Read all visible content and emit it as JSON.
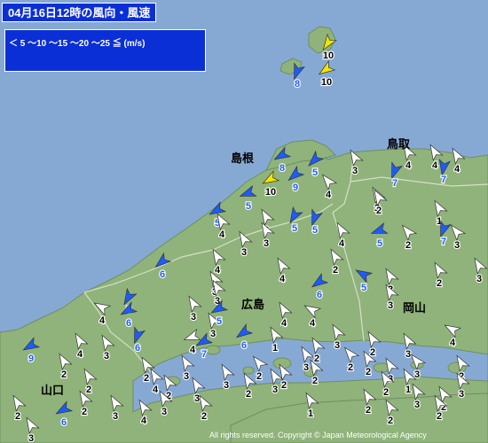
{
  "title": "04月16日12時の風向・風速",
  "legend": {
    "text": "＜ 5  ～10 ～15 ～20 ～25 ≦  (m/s)",
    "classes": [
      {
        "range": "< 5",
        "color": "#ffffff"
      },
      {
        "range": "5–10",
        "color": "#1e5bff"
      },
      {
        "range": "10–15",
        "color": "#f2e600"
      },
      {
        "range": "15–20",
        "color": "#ff8c00"
      },
      {
        "range": "20–25",
        "color": "#ff2800"
      },
      {
        "range": "≧ 25",
        "color": "#b4005a"
      }
    ]
  },
  "prefectures": {
    "shimane": "島根",
    "tottori": "鳥取",
    "hiroshima": "広島",
    "okayama": "岡山",
    "yamaguchi": "山口"
  },
  "credit": "All rights reserved. Copyright © Japan Meteorological Agency",
  "colors": {
    "sea": "#86a9d4",
    "land": "#8fb37a",
    "border": "#d6dfc6"
  },
  "stations": [
    {
      "speed": 10,
      "dir": 215,
      "label_color": "#000000"
    },
    {
      "speed": 10,
      "dir": 235,
      "label_color": "#000000"
    },
    {
      "speed": 8,
      "dir": 200,
      "label_color": "#1e5bff"
    },
    {
      "speed": 8,
      "dir": 240,
      "label_color": "#1e5bff"
    },
    {
      "speed": 5,
      "dir": 225,
      "label_color": "#1e5bff"
    },
    {
      "speed": 9,
      "dir": 230,
      "label_color": "#1e5bff"
    },
    {
      "speed": 10,
      "dir": 240,
      "label_color": "#000000"
    },
    {
      "speed": 3,
      "dir": 330,
      "label_color": "#000000"
    },
    {
      "speed": 4,
      "dir": 330,
      "label_color": "#000000"
    },
    {
      "speed": 7,
      "dir": 200,
      "label_color": "#1e5bff"
    },
    {
      "speed": 4,
      "dir": 330,
      "label_color": "#000000"
    },
    {
      "speed": 4,
      "dir": 330,
      "label_color": "#000000"
    },
    {
      "speed": 2,
      "dir": 330,
      "label_color": "#000000"
    },
    {
      "speed": 7,
      "dir": 190,
      "label_color": "#1e5bff"
    },
    {
      "speed": 4,
      "dir": 320,
      "label_color": "#000000"
    },
    {
      "speed": 5,
      "dir": 240,
      "label_color": "#1e5bff"
    },
    {
      "speed": 5,
      "dir": 250,
      "label_color": "#1e5bff"
    },
    {
      "speed": 5,
      "dir": 210,
      "label_color": "#1e5bff"
    },
    {
      "speed": 5,
      "dir": 200,
      "label_color": "#1e5bff"
    },
    {
      "speed": 2,
      "dir": 330,
      "label_color": "#000000"
    },
    {
      "speed": 2,
      "dir": 320,
      "label_color": "#000000"
    },
    {
      "speed": 1,
      "dir": 330,
      "label_color": "#000000"
    },
    {
      "speed": 7,
      "dir": 200,
      "label_color": "#1e5bff"
    },
    {
      "speed": 3,
      "dir": 330,
      "label_color": "#000000"
    },
    {
      "speed": 3,
      "dir": 320,
      "label_color": "#000000"
    },
    {
      "speed": 4,
      "dir": 330,
      "label_color": "#000000"
    },
    {
      "speed": 5,
      "dir": 250,
      "label_color": "#1e5bff"
    },
    {
      "speed": 3,
      "dir": 330,
      "label_color": "#000000"
    },
    {
      "speed": 4,
      "dir": 330,
      "label_color": "#000000"
    },
    {
      "speed": 3,
      "dir": 330,
      "label_color": "#000000"
    },
    {
      "speed": 3,
      "dir": 330,
      "label_color": "#000000"
    },
    {
      "speed": 5,
      "dir": 300,
      "label_color": "#1e5bff"
    },
    {
      "speed": 2,
      "dir": 330,
      "label_color": "#000000"
    },
    {
      "speed": 2,
      "dir": 330,
      "label_color": "#000000"
    },
    {
      "speed": 6,
      "dir": 230,
      "label_color": "#1e5bff"
    },
    {
      "speed": 4,
      "dir": 330,
      "label_color": "#000000"
    },
    {
      "speed": 3,
      "dir": 330,
      "label_color": "#000000"
    },
    {
      "speed": 4,
      "dir": 330,
      "label_color": "#000000"
    },
    {
      "speed": 2,
      "dir": 330,
      "label_color": "#000000"
    },
    {
      "speed": 6,
      "dir": 235,
      "label_color": "#1e5bff"
    },
    {
      "speed": 5,
      "dir": 210,
      "label_color": "#1e5bff"
    },
    {
      "speed": 3,
      "dir": 330,
      "label_color": "#000000"
    },
    {
      "speed": 3,
      "dir": 330,
      "label_color": "#000000"
    },
    {
      "speed": 3,
      "dir": 330,
      "label_color": "#000000"
    },
    {
      "speed": 6,
      "dir": 240,
      "label_color": "#1e5bff"
    },
    {
      "speed": 4,
      "dir": 300,
      "label_color": "#000000"
    },
    {
      "speed": 6,
      "dir": 200,
      "label_color": "#1e5bff"
    },
    {
      "speed": 3,
      "dir": 330,
      "label_color": "#000000"
    },
    {
      "speed": 4,
      "dir": 330,
      "label_color": "#000000"
    },
    {
      "speed": 5,
      "dir": 240,
      "label_color": "#1e5bff"
    },
    {
      "speed": 4,
      "dir": 300,
      "label_color": "#000000"
    },
    {
      "speed": 4,
      "dir": 250,
      "label_color": "#000000"
    },
    {
      "speed": 6,
      "dir": 235,
      "label_color": "#1e5bff"
    },
    {
      "speed": 7,
      "dir": 240,
      "label_color": "#1e5bff"
    },
    {
      "speed": 3,
      "dir": 330,
      "label_color": "#000000"
    },
    {
      "speed": 2,
      "dir": 320,
      "label_color": "#000000"
    },
    {
      "speed": 2,
      "dir": 330,
      "label_color": "#000000"
    },
    {
      "speed": 3,
      "dir": 330,
      "label_color": "#000000"
    },
    {
      "speed": 2,
      "dir": 330,
      "label_color": "#000000"
    },
    {
      "speed": 3,
      "dir": 330,
      "label_color": "#000000"
    },
    {
      "speed": 4,
      "dir": 300,
      "label_color": "#000000"
    },
    {
      "speed": 9,
      "dir": 240,
      "label_color": "#1e5bff"
    },
    {
      "speed": 4,
      "dir": 330,
      "label_color": "#000000"
    },
    {
      "speed": 3,
      "dir": 330,
      "label_color": "#000000"
    },
    {
      "speed": 2,
      "dir": 330,
      "label_color": "#000000"
    },
    {
      "speed": 2,
      "dir": 330,
      "label_color": "#000000"
    },
    {
      "speed": 1,
      "dir": 330,
      "label_color": "#000000"
    },
    {
      "speed": 3,
      "dir": 330,
      "label_color": "#000000"
    },
    {
      "speed": 2,
      "dir": 320,
      "label_color": "#000000"
    },
    {
      "speed": 2,
      "dir": 330,
      "label_color": "#000000"
    },
    {
      "speed": 2,
      "dir": 330,
      "label_color": "#000000"
    },
    {
      "speed": 4,
      "dir": 330,
      "label_color": "#000000"
    },
    {
      "speed": 3,
      "dir": 330,
      "label_color": "#000000"
    },
    {
      "speed": 2,
      "dir": 330,
      "label_color": "#000000"
    },
    {
      "speed": 3,
      "dir": 330,
      "label_color": "#000000"
    },
    {
      "speed": 2,
      "dir": 330,
      "label_color": "#000000"
    },
    {
      "speed": 3,
      "dir": 330,
      "label_color": "#000000"
    },
    {
      "speed": 2,
      "dir": 330,
      "label_color": "#000000"
    },
    {
      "speed": 2,
      "dir": 330,
      "label_color": "#000000"
    },
    {
      "speed": 3,
      "dir": 330,
      "label_color": "#000000"
    },
    {
      "speed": 3,
      "dir": 320,
      "label_color": "#000000"
    },
    {
      "speed": 2,
      "dir": 330,
      "label_color": "#000000"
    },
    {
      "speed": 3,
      "dir": 330,
      "label_color": "#000000"
    },
    {
      "speed": 2,
      "dir": 330,
      "label_color": "#000000"
    },
    {
      "speed": 1,
      "dir": 330,
      "label_color": "#000000"
    },
    {
      "speed": 1,
      "dir": 330,
      "label_color": "#000000"
    },
    {
      "speed": 2,
      "dir": 330,
      "label_color": "#000000"
    },
    {
      "speed": 3,
      "dir": 330,
      "label_color": "#000000"
    },
    {
      "speed": 2,
      "dir": 330,
      "label_color": "#000000"
    },
    {
      "speed": 3,
      "dir": 330,
      "label_color": "#000000"
    },
    {
      "speed": 6,
      "dir": 240,
      "label_color": "#1e5bff"
    },
    {
      "speed": 2,
      "dir": 330,
      "label_color": "#000000"
    },
    {
      "speed": 3,
      "dir": 330,
      "label_color": "#000000"
    },
    {
      "speed": 2,
      "dir": 330,
      "label_color": "#000000"
    },
    {
      "speed": 3,
      "dir": 330,
      "label_color": "#000000"
    },
    {
      "speed": 4,
      "dir": 330,
      "label_color": "#000000"
    },
    {
      "speed": 2,
      "dir": 330,
      "label_color": "#000000"
    },
    {
      "speed": 2,
      "dir": 330,
      "label_color": "#000000"
    },
    {
      "speed": 2,
      "dir": 330,
      "label_color": "#000000"
    },
    {
      "speed": 2,
      "dir": 330,
      "label_color": "#000000"
    }
  ]
}
